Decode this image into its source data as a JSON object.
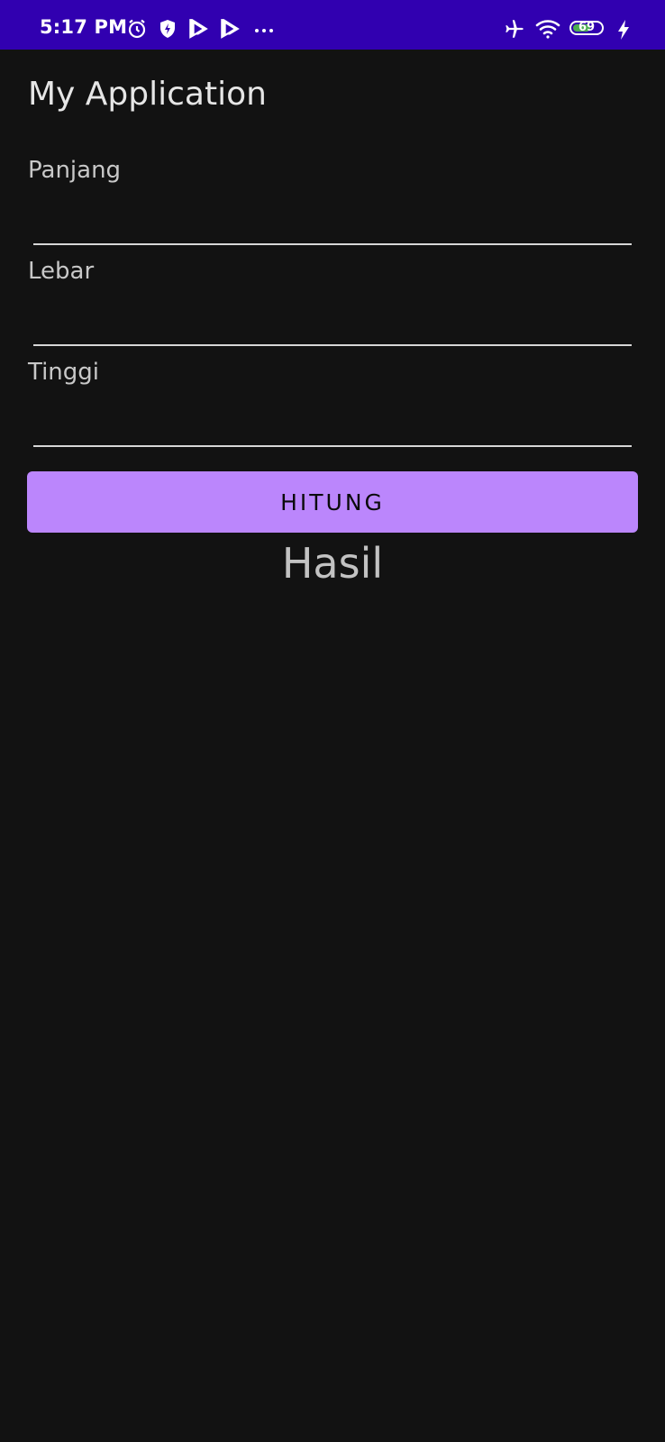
{
  "status_bar": {
    "time": "5:17 PM",
    "battery_level": "69",
    "battery_fraction": 0.69,
    "background_color": "#3100b0",
    "battery_fill_color": "#4caf50",
    "icons": [
      "alarm-icon",
      "shield-bolt-icon",
      "play-icon",
      "play-icon",
      "more-dots-icon",
      "airplane-icon",
      "wifi-icon",
      "battery-icon",
      "charging-bolt-icon"
    ]
  },
  "app": {
    "title": "My Application",
    "background_color": "#121212"
  },
  "form": {
    "fields": [
      {
        "label": "Panjang",
        "value": ""
      },
      {
        "label": "Lebar",
        "value": ""
      },
      {
        "label": "Tinggi",
        "value": ""
      }
    ],
    "button_label": "HITUNG",
    "button_color": "#bb86fc"
  },
  "result": {
    "text": "Hasil"
  }
}
